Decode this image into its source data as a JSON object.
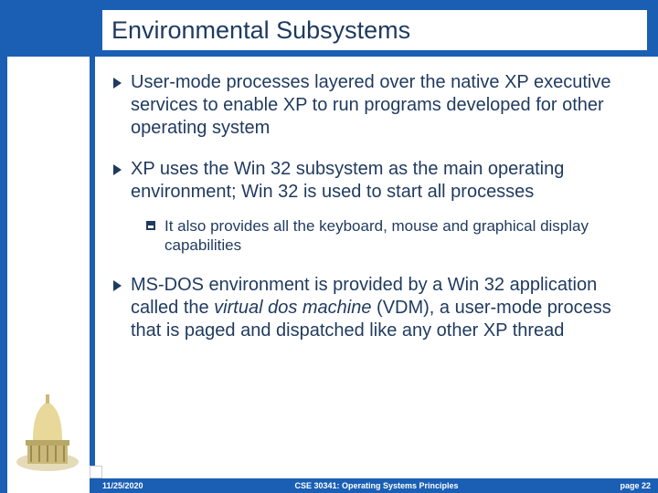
{
  "title": "Environmental Subsystems",
  "bullets": {
    "b1": "User-mode processes layered over the native XP executive services to enable XP to run programs developed for other operating system",
    "b2": "XP uses the Win 32 subsystem as the main operating environment; Win 32 is used to start all processes",
    "b2_sub": "It also provides all the keyboard, mouse and graphical display capabilities",
    "b3_pre": "MS-DOS environment is provided by a Win 32 application called the ",
    "b3_italic": "virtual dos machine",
    "b3_post": " (VDM), a user-mode process that is paged and dispatched like any other XP thread"
  },
  "footer": {
    "date": "11/25/2020",
    "course": "CSE 30341: Operating Systems Principles",
    "page": "page 22"
  }
}
